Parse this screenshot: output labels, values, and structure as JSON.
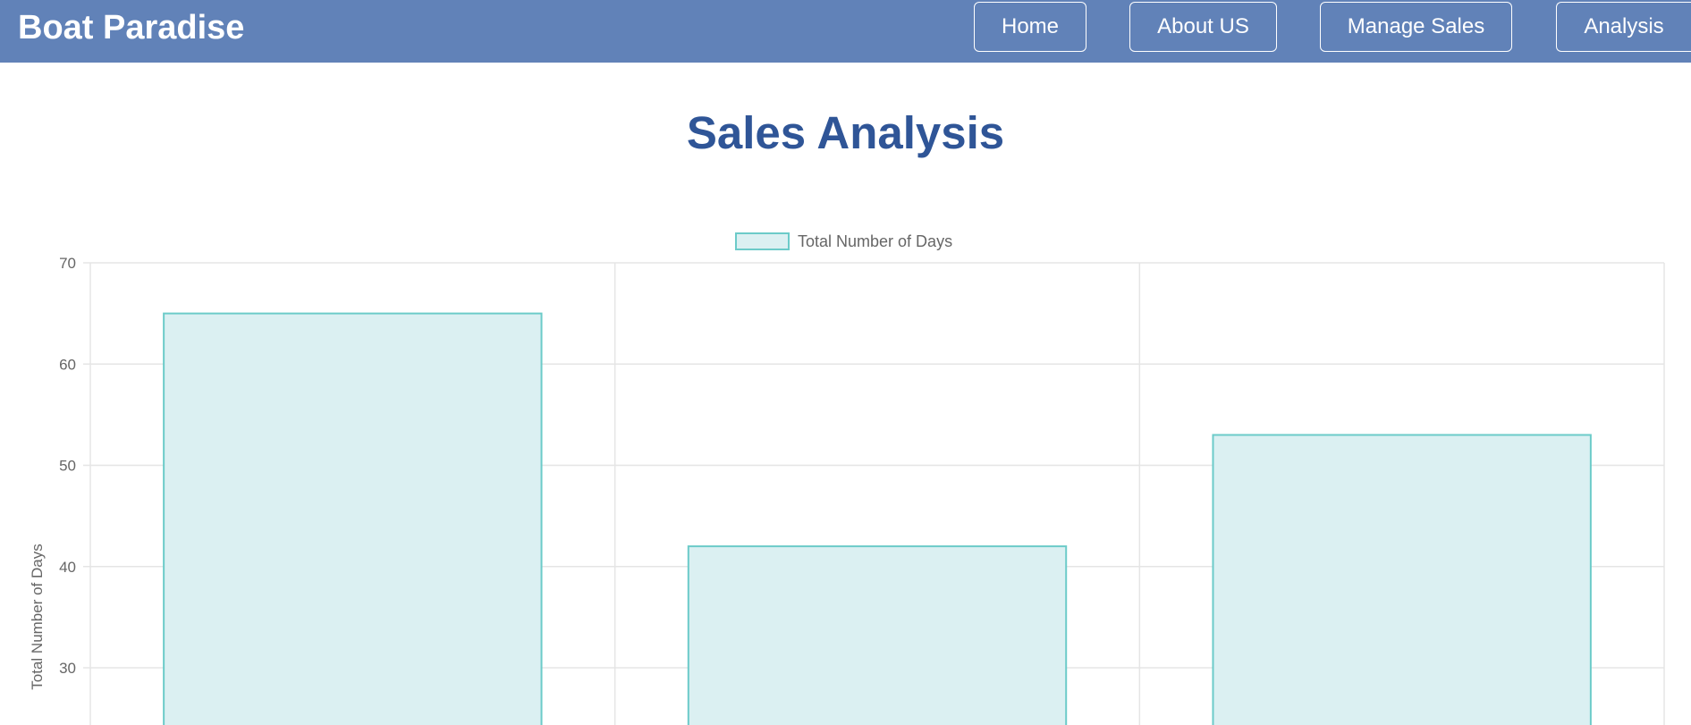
{
  "header": {
    "brand": "Boat Paradise",
    "nav": [
      {
        "label": "Home"
      },
      {
        "label": "About US"
      },
      {
        "label": "Manage Sales"
      },
      {
        "label": "Analysis"
      }
    ]
  },
  "main": {
    "title": "Sales Analysis"
  },
  "colors": {
    "navbar": "#6182b8",
    "title": "#2f5597",
    "bar_fill": "#dbf0f2",
    "bar_border": "#6ccbc9",
    "grid": "#e5e5e5"
  },
  "chart_data": {
    "type": "bar",
    "categories": [
      "",
      "",
      ""
    ],
    "series": [
      {
        "name": "Total Number of Days",
        "values": [
          65,
          42,
          53
        ]
      }
    ],
    "ylabel": "Total Number of Days",
    "ylim": [
      30,
      70
    ],
    "yticks": [
      70,
      60,
      50,
      40,
      30
    ],
    "grid": true,
    "legend_position": "top-center"
  }
}
